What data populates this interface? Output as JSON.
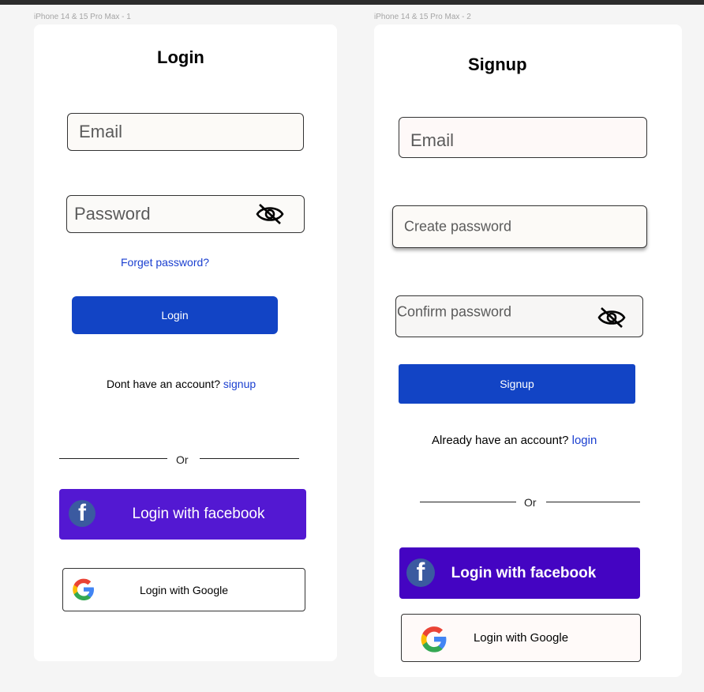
{
  "frames": {
    "login_label": "iPhone 14 & 15 Pro Max - 1",
    "signup_label": "iPhone 14 & 15 Pro Max - 2"
  },
  "login": {
    "title": "Login",
    "email_placeholder": "Email",
    "password_placeholder": "Password",
    "forgot_link": "Forget password?",
    "login_button": "Login",
    "no_account_text": "Dont have an account?",
    "signup_link": "signup",
    "or_text": "Or",
    "facebook_button": "Login with facebook",
    "google_button": "Login with Google"
  },
  "signup": {
    "title": "Signup",
    "email_placeholder": "Email",
    "create_password_placeholder": "Create password",
    "confirm_password_placeholder": "Confirm password",
    "signup_button": "Signup",
    "have_account_text": "Already have an account?",
    "login_link": "login",
    "or_text": "Or",
    "facebook_button": "Login with facebook",
    "google_button": "Login with Google"
  },
  "icons": {
    "eye": "eye-slash-icon",
    "facebook": "facebook-icon",
    "google": "google-icon"
  },
  "colors": {
    "primary_blue": "#1244c5",
    "facebook_purple_1": "#5318d2",
    "facebook_purple_2": "#4404c2",
    "link_blue": "#1a3fd0"
  }
}
